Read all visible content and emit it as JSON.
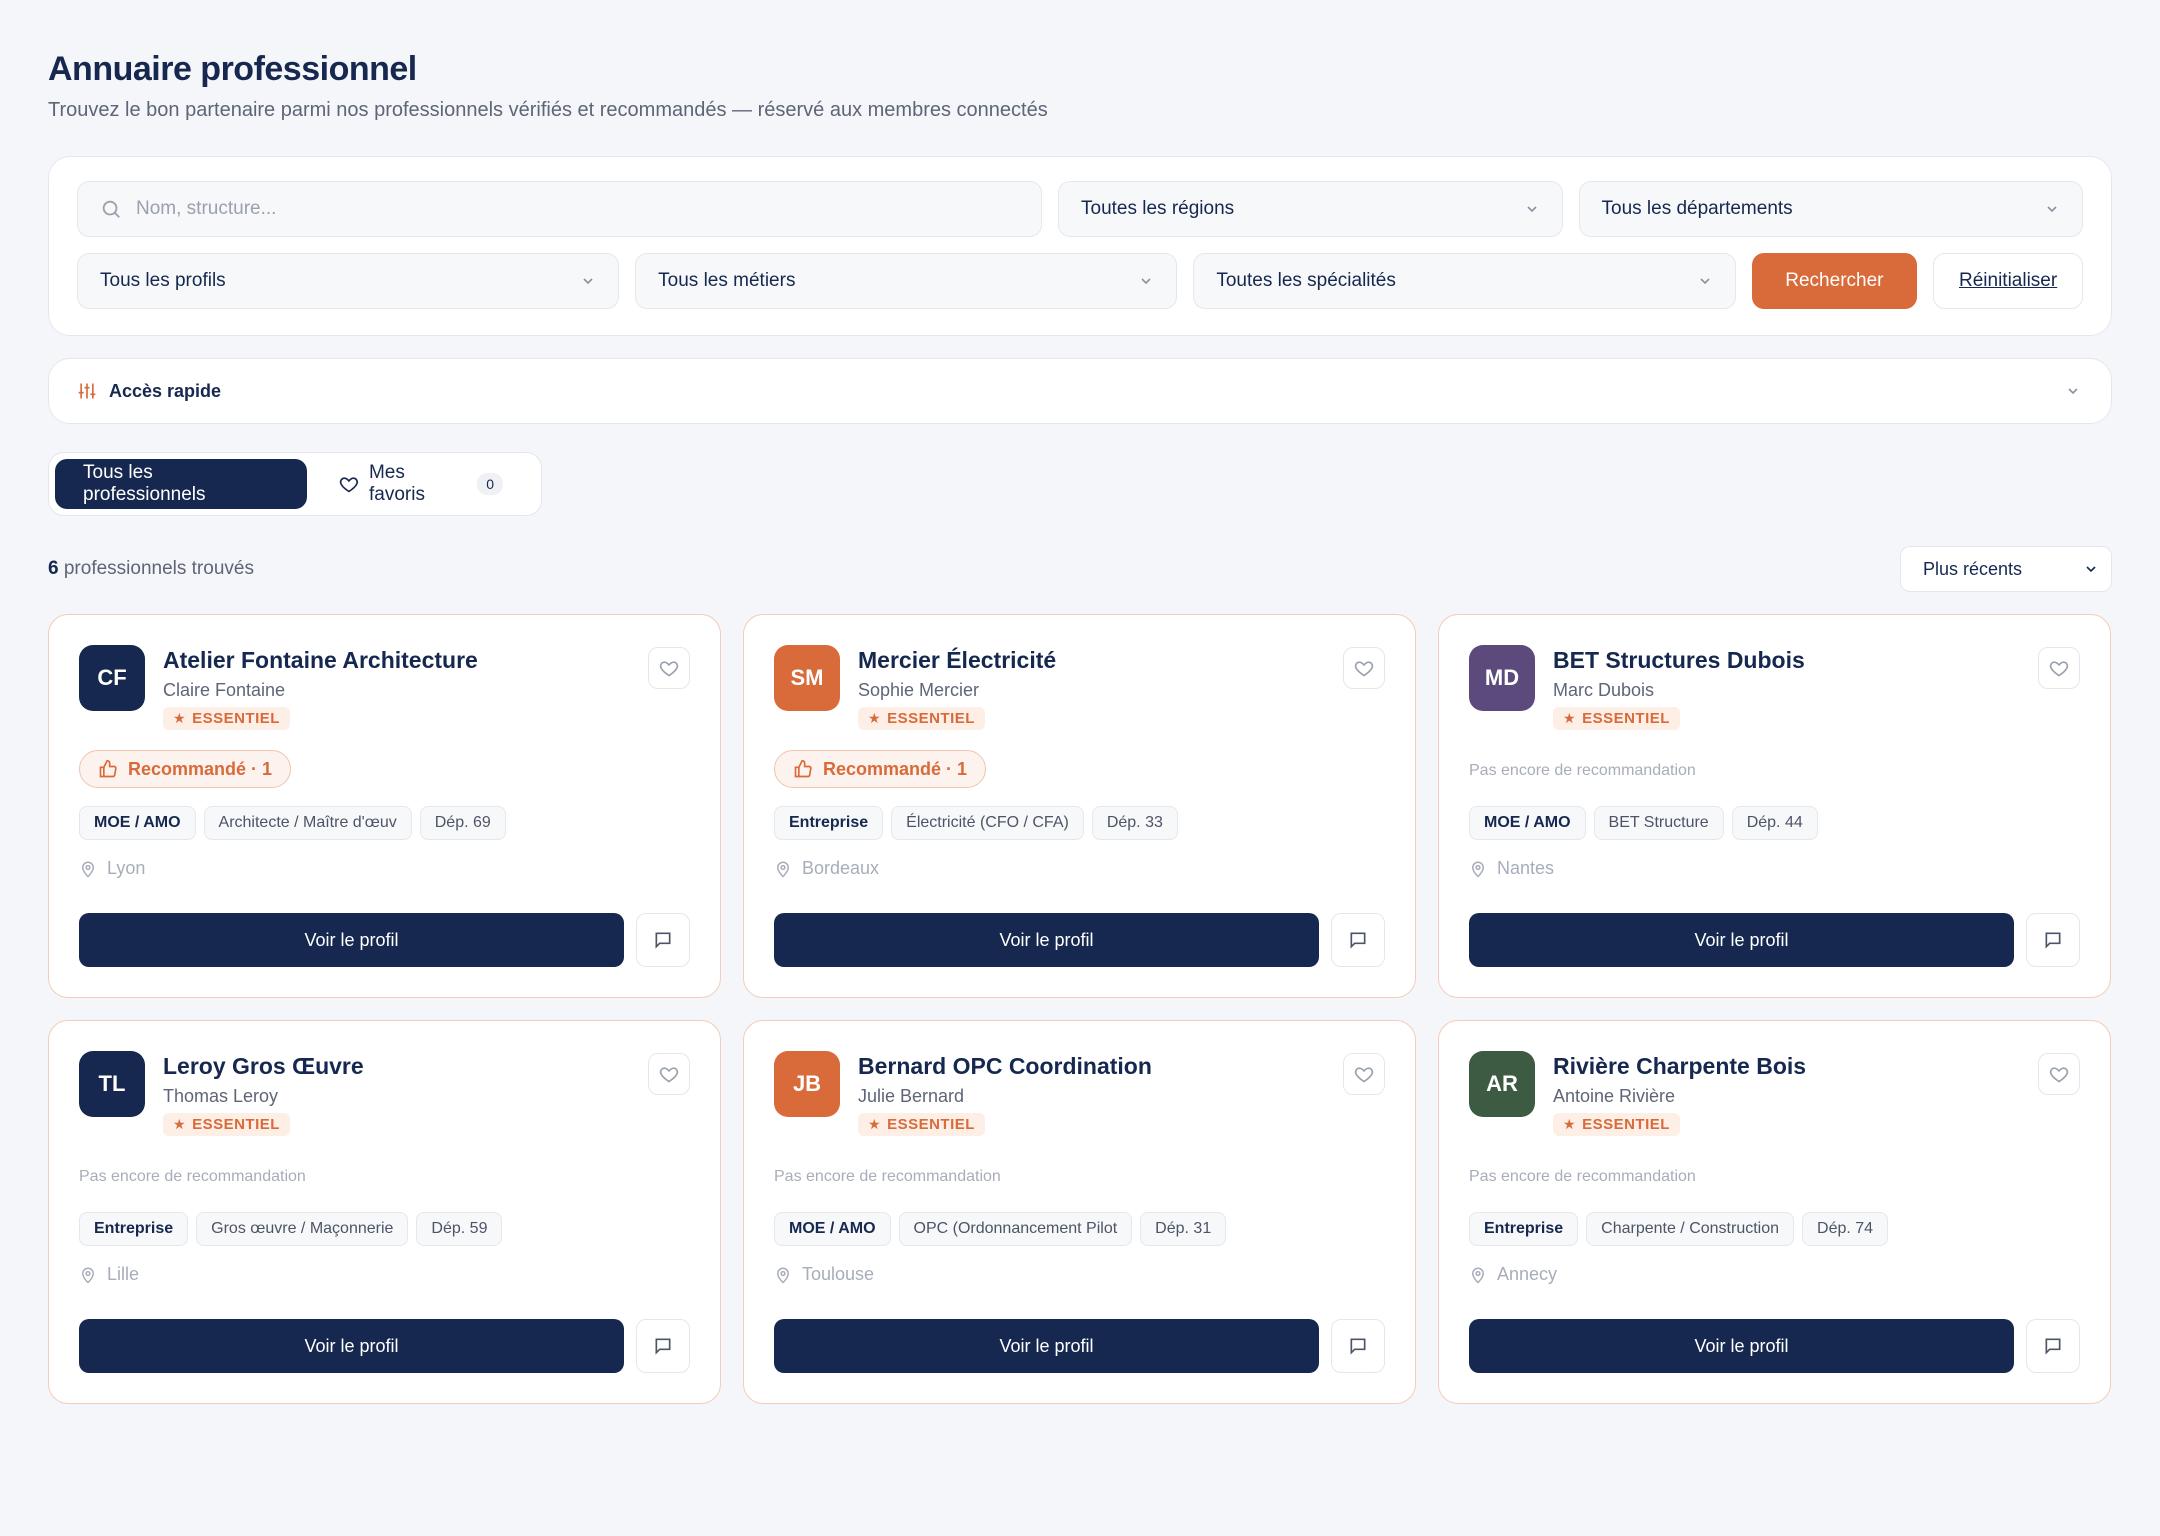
{
  "header": {
    "title": "Annuaire professionnel",
    "subtitle": "Trouvez le bon partenaire parmi nos professionnels vérifiés et recommandés — réservé aux membres connectés"
  },
  "filters": {
    "search_placeholder": "Nom, structure...",
    "region": "Toutes les régions",
    "department": "Tous les départements",
    "profile": "Tous les profils",
    "trade": "Tous les métiers",
    "specialty": "Toutes les spécialités",
    "search_label": "Rechercher",
    "reset_label": "Réinitialiser"
  },
  "quick_access": {
    "label": "Accès rapide"
  },
  "tabs": {
    "all": "Tous les professionnels",
    "favorites": "Mes favoris",
    "favorites_count": "0"
  },
  "results": {
    "count": "6",
    "count_suffix": " professionnels trouvés",
    "sort": "Plus récents"
  },
  "cards": [
    {
      "initials": "CF",
      "color": "#16284f",
      "name": "Atelier Fontaine Architecture",
      "person": "Claire Fontaine",
      "badge": "ESSENTIEL",
      "reco": "Recommandé · 1",
      "tags": [
        "MOE / AMO",
        "Architecte / Maître d'œuv",
        "Dép. 69"
      ],
      "location": "Lyon",
      "cta": "Voir le profil"
    },
    {
      "initials": "SM",
      "color": "#d96a3a",
      "name": "Mercier Électricité",
      "person": "Sophie Mercier",
      "badge": "ESSENTIEL",
      "reco": "Recommandé · 1",
      "tags": [
        "Entreprise",
        "Électricité (CFO / CFA)",
        "Dép. 33"
      ],
      "location": "Bordeaux",
      "cta": "Voir le profil"
    },
    {
      "initials": "MD",
      "color": "#5c4a7d",
      "name": "BET Structures Dubois",
      "person": "Marc Dubois",
      "badge": "ESSENTIEL",
      "reco": "",
      "no_reco": "Pas encore de recommandation",
      "tags": [
        "MOE / AMO",
        "BET Structure",
        "Dép. 44"
      ],
      "location": "Nantes",
      "cta": "Voir le profil"
    },
    {
      "initials": "TL",
      "color": "#16284f",
      "name": "Leroy Gros Œuvre",
      "person": "Thomas Leroy",
      "badge": "ESSENTIEL",
      "reco": "",
      "no_reco": "Pas encore de recommandation",
      "tags": [
        "Entreprise",
        "Gros œuvre / Maçonnerie",
        "Dép. 59"
      ],
      "location": "Lille",
      "cta": "Voir le profil"
    },
    {
      "initials": "JB",
      "color": "#d96a3a",
      "name": "Bernard OPC Coordination",
      "person": "Julie Bernard",
      "badge": "ESSENTIEL",
      "reco": "",
      "no_reco": "Pas encore de recommandation",
      "tags": [
        "MOE / AMO",
        "OPC (Ordonnancement Pilot",
        "Dép. 31"
      ],
      "location": "Toulouse",
      "cta": "Voir le profil"
    },
    {
      "initials": "AR",
      "color": "#3d5a43",
      "name": "Rivière Charpente Bois",
      "person": "Antoine Rivière",
      "badge": "ESSENTIEL",
      "reco": "",
      "no_reco": "Pas encore de recommandation",
      "tags": [
        "Entreprise",
        "Charpente / Construction",
        "Dép. 74"
      ],
      "location": "Annecy",
      "cta": "Voir le profil"
    }
  ]
}
